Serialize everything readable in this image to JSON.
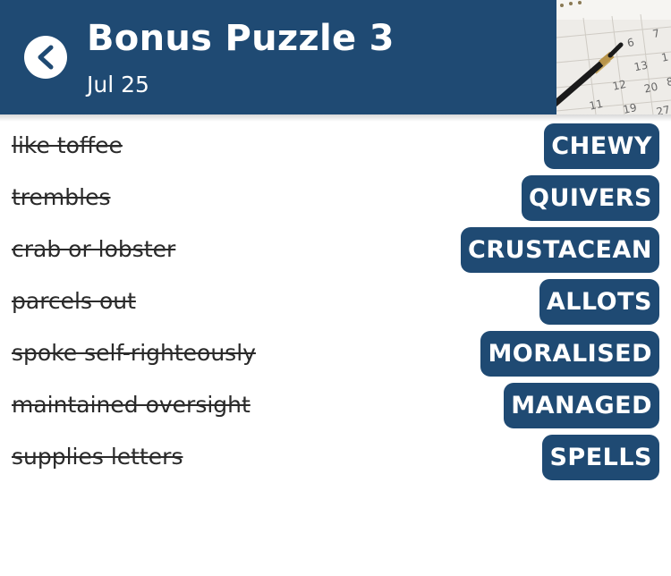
{
  "header": {
    "title": "Bonus Puzzle 3",
    "date": "Jul 25",
    "calendar_numbers": [
      "6",
      "7",
      "13",
      "1",
      "12",
      "20",
      "11",
      "19",
      "27",
      "8"
    ]
  },
  "colors": {
    "accent": "#1f4a73",
    "background": "#ffffff",
    "text": "#2a2a2a"
  },
  "rows": [
    {
      "clue": "like toffee",
      "answer": "CHEWY"
    },
    {
      "clue": "trembles",
      "answer": "QUIVERS"
    },
    {
      "clue": "crab or lobster",
      "answer": "CRUSTACEAN"
    },
    {
      "clue": "parcels out",
      "answer": "ALLOTS"
    },
    {
      "clue": "spoke self-righteously",
      "answer": "MORALISED"
    },
    {
      "clue": "maintained oversight",
      "answer": "MANAGED"
    },
    {
      "clue": "supplies letters",
      "answer": "SPELLS"
    }
  ]
}
